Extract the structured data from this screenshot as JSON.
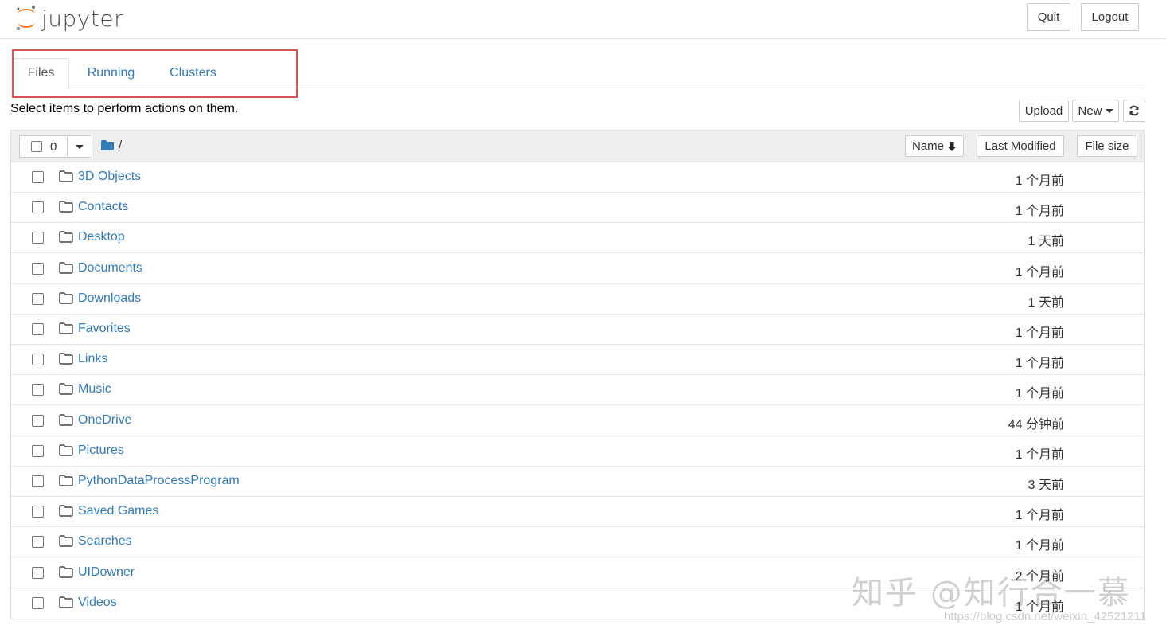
{
  "app": {
    "name": "jupyter"
  },
  "header": {
    "quit_label": "Quit",
    "logout_label": "Logout"
  },
  "tabs": [
    {
      "label": "Files",
      "active": true
    },
    {
      "label": "Running",
      "active": false
    },
    {
      "label": "Clusters",
      "active": false
    }
  ],
  "toolbar": {
    "message": "Select items to perform actions on them.",
    "upload_label": "Upload",
    "new_label": "New",
    "refresh_icon": "refresh-icon"
  },
  "list_header": {
    "selected_count": "0",
    "breadcrumb": "/",
    "sort_name_label": "Name",
    "sort_modified_label": "Last Modified",
    "sort_size_label": "File size"
  },
  "files": [
    {
      "name": "3D Objects",
      "modified": "1 个月前"
    },
    {
      "name": "Contacts",
      "modified": "1 个月前"
    },
    {
      "name": "Desktop",
      "modified": "1 天前"
    },
    {
      "name": "Documents",
      "modified": "1 个月前"
    },
    {
      "name": "Downloads",
      "modified": "1 天前"
    },
    {
      "name": "Favorites",
      "modified": "1 个月前"
    },
    {
      "name": "Links",
      "modified": "1 个月前"
    },
    {
      "name": "Music",
      "modified": "1 个月前"
    },
    {
      "name": "OneDrive",
      "modified": "44 分钟前"
    },
    {
      "name": "Pictures",
      "modified": "1 个月前"
    },
    {
      "name": "PythonDataProcessProgram",
      "modified": "3 天前"
    },
    {
      "name": "Saved Games",
      "modified": "1 个月前"
    },
    {
      "name": "Searches",
      "modified": "1 个月前"
    },
    {
      "name": "UIDowner",
      "modified": "2 个月前"
    },
    {
      "name": "Videos",
      "modified": "1 个月前"
    }
  ],
  "watermark": {
    "text": "知乎 @知行合一慕",
    "url": "https://blog.csdn.net/weixin_42521211"
  },
  "colors": {
    "link": "#337ab7",
    "logo_orange": "#f37726",
    "highlight": "#d9534f"
  }
}
